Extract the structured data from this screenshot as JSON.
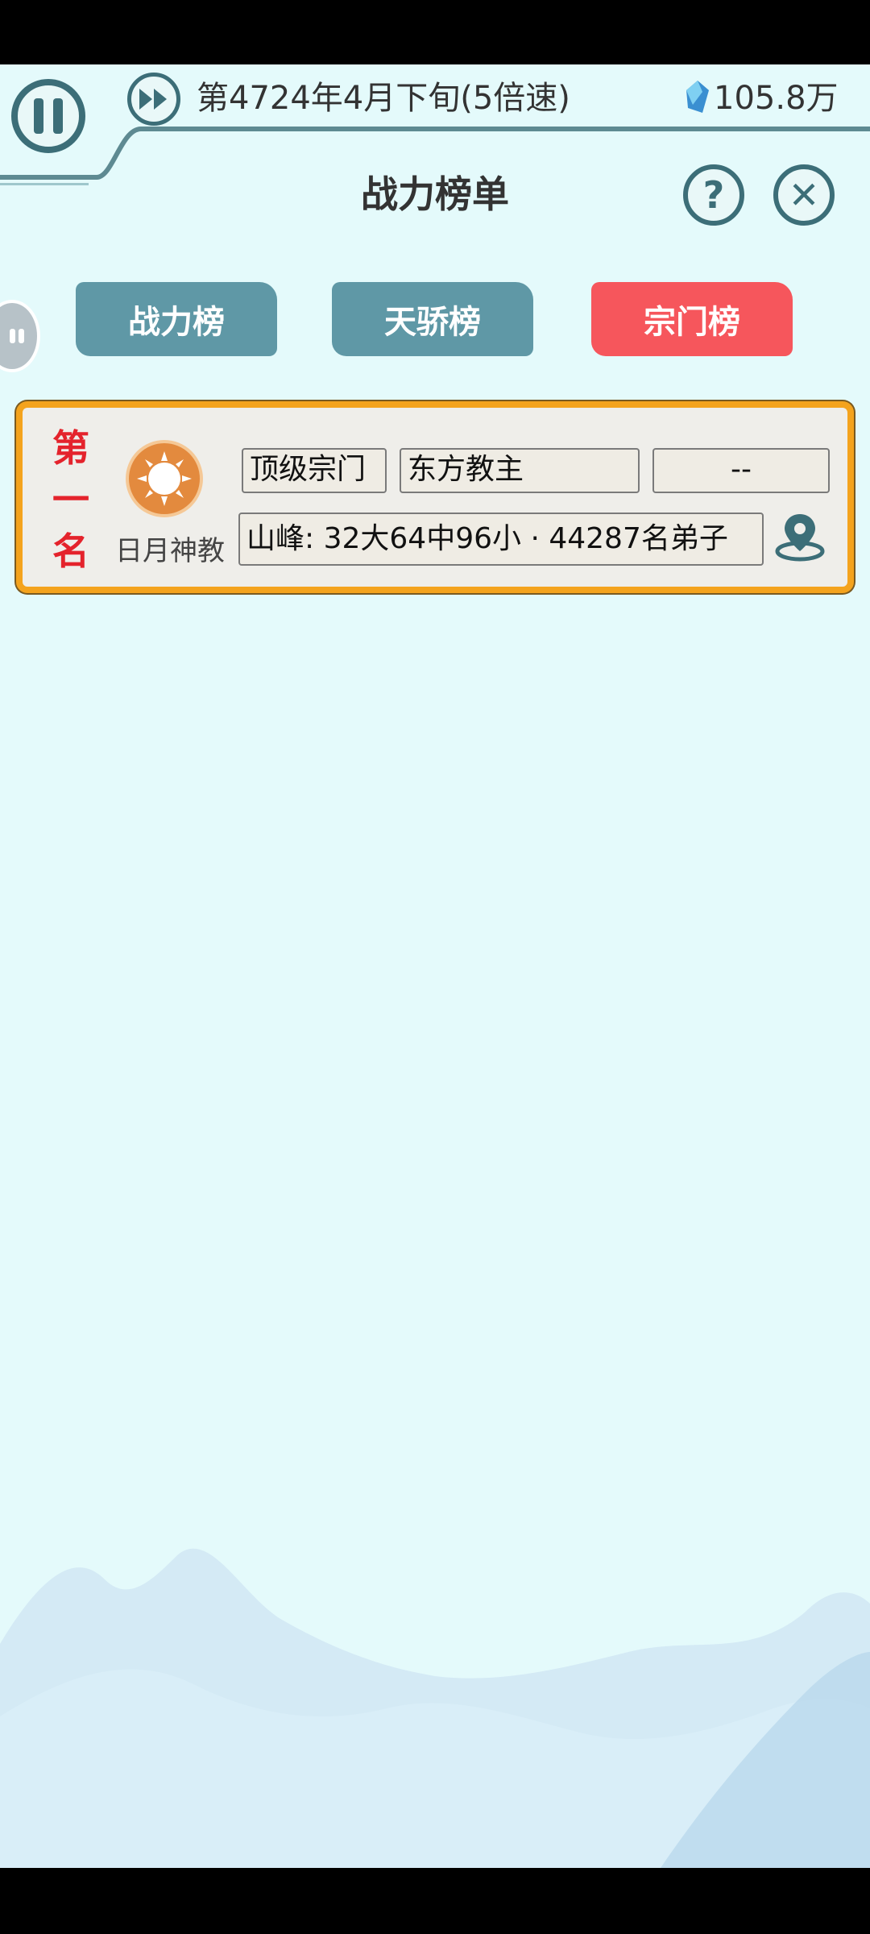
{
  "header": {
    "date_text": "第4724年4月下旬(5倍速)",
    "gem_value": "105.8万",
    "title": "战力榜单"
  },
  "tabs": [
    {
      "label": "战力榜",
      "active": false
    },
    {
      "label": "天骄榜",
      "active": false
    },
    {
      "label": "宗门榜",
      "active": true
    }
  ],
  "ranking": {
    "rank_chars": [
      "第",
      "一",
      "名"
    ],
    "sect_name": "日月神教",
    "tier": "顶级宗门",
    "leader": "东方教主",
    "extra": "--",
    "details": "山峰: 32大64中96小 · 44287名弟子"
  },
  "icons": {
    "pause": "pause-icon",
    "fast_forward": "fast-forward-icon",
    "gem": "gem-icon",
    "help": "help-icon",
    "close": "close-icon",
    "location": "location-pin-icon"
  },
  "colors": {
    "background": "#e4fafb",
    "accent_dark": "#3c6e78",
    "tab_inactive": "#5f98a6",
    "tab_active": "#f6565c",
    "card_border": "#f4a31d",
    "rank_red": "#e4232c"
  }
}
